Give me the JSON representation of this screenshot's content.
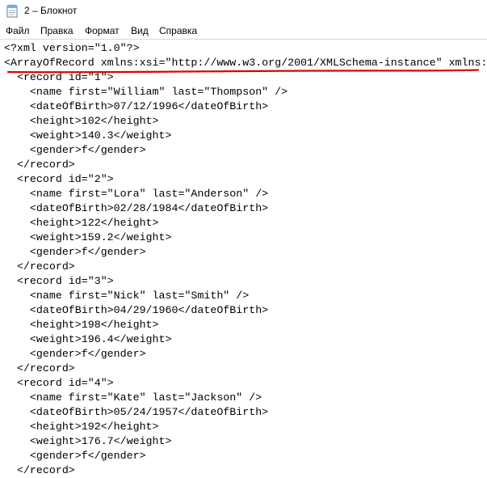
{
  "window": {
    "title": "2 – Блокнот",
    "icon": "notepad-icon"
  },
  "menu": {
    "items": [
      "Файл",
      "Правка",
      "Формат",
      "Вид",
      "Справка"
    ]
  },
  "editor": {
    "lines": [
      "<?xml version=\"1.0\"?>",
      "<ArrayOfRecord xmlns:xsi=\"http://www.w3.org/2001/XMLSchema-instance\" xmlns:",
      "  <record id=\"1\">",
      "    <name first=\"William\" last=\"Thompson\" />",
      "    <dateOfBirth>07/12/1996</dateOfBirth>",
      "    <height>102</height>",
      "    <weight>140.3</weight>",
      "    <gender>f</gender>",
      "  </record>",
      "  <record id=\"2\">",
      "    <name first=\"Lora\" last=\"Anderson\" />",
      "    <dateOfBirth>02/28/1984</dateOfBirth>",
      "    <height>122</height>",
      "    <weight>159.2</weight>",
      "    <gender>f</gender>",
      "  </record>",
      "  <record id=\"3\">",
      "    <name first=\"Nick\" last=\"Smith\" />",
      "    <dateOfBirth>04/29/1960</dateOfBirth>",
      "    <height>198</height>",
      "    <weight>196.4</weight>",
      "    <gender>f</gender>",
      "  </record>",
      "  <record id=\"4\">",
      "    <name first=\"Kate\" last=\"Jackson\" />",
      "    <dateOfBirth>05/24/1957</dateOfBirth>",
      "    <height>192</height>",
      "    <weight>176.7</weight>",
      "    <gender>f</gender>",
      "  </record>"
    ]
  },
  "annotation": {
    "color": "#e00000"
  }
}
